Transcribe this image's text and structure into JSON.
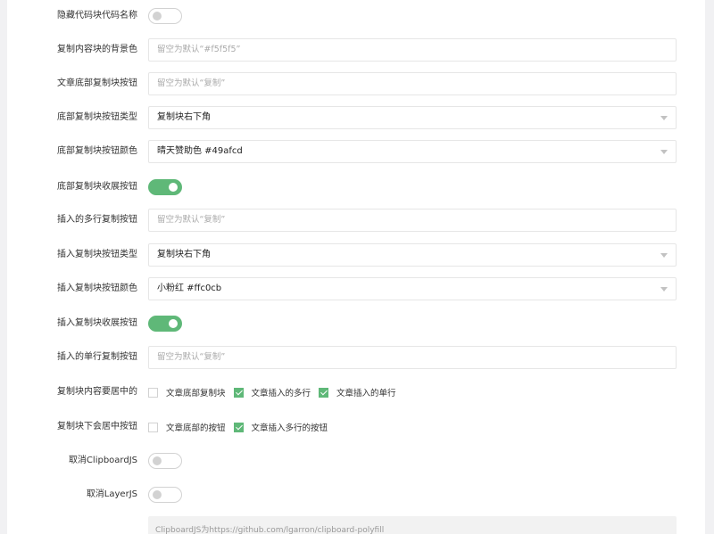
{
  "settings": {
    "hide_block_name": {
      "label": "隐藏代码块代码名称",
      "on": false
    },
    "copy_bg": {
      "label": "复制内容块的背景色",
      "placeholder": "留空为默认“#f5f5f5”"
    },
    "bottom_copy_text": {
      "label": "文章底部复制块按钮",
      "placeholder": "留空为默认“复制”"
    },
    "bottom_btn_type": {
      "label": "底部复制块按钮类型",
      "value": "复制块右下角"
    },
    "bottom_btn_color": {
      "label": "底部复制块按钮颜色",
      "value": "晴天赞助色 #49afcd"
    },
    "bottom_collapse": {
      "label": "底部复制块收展按钮",
      "on": true
    },
    "insert_multi_text": {
      "label": "插入的多行复制按钮",
      "placeholder": "留空为默认“复制”"
    },
    "insert_btn_type": {
      "label": "插入复制块按钮类型",
      "value": "复制块右下角"
    },
    "insert_btn_color": {
      "label": "插入复制块按钮颜色",
      "value": "小粉红 #ffc0cb"
    },
    "insert_collapse": {
      "label": "插入复制块收展按钮",
      "on": true
    },
    "insert_single_text": {
      "label": "插入的单行复制按钮",
      "placeholder": "留空为默认“复制”"
    },
    "content_center": {
      "label": "复制块内容要居中的",
      "options": [
        {
          "text": "文章底部复制块",
          "checked": false
        },
        {
          "text": "文章插入的多行",
          "checked": true
        },
        {
          "text": "文章插入的单行",
          "checked": true
        }
      ]
    },
    "button_center": {
      "label": "复制块下会居中按钮",
      "options": [
        {
          "text": "文章底部的按钮",
          "checked": false
        },
        {
          "text": "文章插入多行的按钮",
          "checked": true
        }
      ]
    },
    "disable_clipboardjs": {
      "label": "取消ClipboardJS",
      "on": false
    },
    "disable_layerjs": {
      "label": "取消LayerJS",
      "on": false
    },
    "note_text": "ClipboardJS为https://github.com/lgarron/clipboard-polyfill"
  },
  "colors": {
    "accent": "#5fb878",
    "switch_off": "#d2d2d2"
  },
  "icons": {
    "select_arrow": "caret-down-icon",
    "check": "checkmark-icon"
  }
}
